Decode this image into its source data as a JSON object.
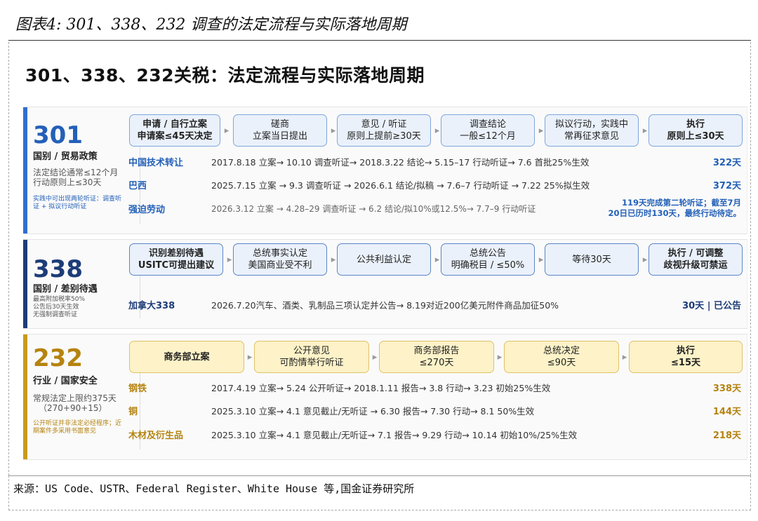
{
  "figure_title": "图表4: 301、338、232 调查的法定流程与实际落地周期",
  "main_title": "301、338、232关税：法定流程与实际落地周期",
  "source": "来源：US Code、USTR、Federal Register、White House 等,国金证券研究所",
  "colors": {
    "blue": "#2360b8",
    "navy": "#1d3c78",
    "gold": "#b58310"
  },
  "s301": {
    "number": "301",
    "category": "国别 / 贸易政策",
    "note1": "法定结论通常≤12个月",
    "note2": "行动原则上≤30天",
    "note3": "实践中可出现两轮听证：调查听证 + 拟议行动听证",
    "steps": [
      {
        "l1": "申请 / 自行立案",
        "l2": "申请案≤45天决定"
      },
      {
        "l1": "磋商",
        "l2": "立案当日提出"
      },
      {
        "l1": "意见 / 听证",
        "l2": "原则上提前≥30天"
      },
      {
        "l1": "调查结论",
        "l2": "一般≤12个月"
      },
      {
        "l1": "拟议行动，实践中",
        "l2": "常再征求意见"
      },
      {
        "l1": "执行",
        "l2": "原则上≤30天"
      }
    ],
    "cases": [
      {
        "name": "中国技术转让",
        "desc": "2017.8.18 立案→ 10.10 调查听证→ 2018.3.22 结论→ 5.15–17 行动听证→ 7.6 首批25%生效",
        "dur": "322天"
      },
      {
        "name": "巴西",
        "desc": "2025.7.15 立案 → 9.3 调查听证 → 2026.6.1 结论/拟稿 → 7.6–7 行动听证 → 7.22 25%拟生效",
        "dur": "372天"
      },
      {
        "name": "强迫劳动",
        "desc": "2026.3.12 立案 → 4.28–29 调查听证 → 6.2 结论/拟10%或12.5%→ 7.7–9 行动听证",
        "dur1": "119天完成第二轮听证；截至7月",
        "dur2": "20日已历时130天，最终行动待定。"
      }
    ]
  },
  "s338": {
    "number": "338",
    "category": "国别 / 差别待遇",
    "note1": "最高附加税率50%",
    "note2": "公告后30天生效",
    "note3": "无强制调查听证",
    "steps": [
      {
        "l1": "识别差别待遇",
        "l2": "USITC可提出建议"
      },
      {
        "l1": "总统事实认定",
        "l2": "美国商业受不利"
      },
      {
        "l1": "公共利益认定",
        "l2": ""
      },
      {
        "l1": "总统公告",
        "l2": "明确税目 / ≤50%"
      },
      {
        "l1": "等待30天",
        "l2": ""
      },
      {
        "l1": "执行 / 可调整",
        "l2": "歧视升级可禁运"
      }
    ],
    "cases": [
      {
        "name": "加拿大338",
        "desc": "2026.7.20汽车、酒类、乳制品三项认定并公告→ 8.19对近200亿美元附件商品加征50%",
        "dur": "30天 | 已公告"
      }
    ]
  },
  "s232": {
    "number": "232",
    "category": "行业 / 国家安全",
    "note1": "常规法定上限约375天",
    "note2": "（270+90+15）",
    "note3": "公开听证并非法定必经程序；近期案件多采用书面意见",
    "steps": [
      {
        "l1": "商务部立案",
        "l2": ""
      },
      {
        "l1": "公开意见",
        "l2": "可酌情举行听证"
      },
      {
        "l1": "商务部报告",
        "l2": "≤270天"
      },
      {
        "l1": "总统决定",
        "l2": "≤90天"
      },
      {
        "l1": "执行",
        "l2": "≤15天"
      }
    ],
    "cases": [
      {
        "name": "钢铁",
        "desc": "2017.4.19 立案→ 5.24 公开听证→ 2018.1.11 报告→ 3.8 行动→ 3.23 初始25%生效",
        "dur": "338天"
      },
      {
        "name": "铜",
        "desc": "2025.3.10 立案→ 4.1 意见截止/无听证 → 6.30 报告→ 7.30 行动→ 8.1 50%生效",
        "dur": "144天"
      },
      {
        "name": "木材及衍生品",
        "desc": "2025.3.10 立案→ 4.1 意见截止/无听证→ 7.1 报告→ 9.29 行动→ 10.14 初始10%/25%生效",
        "dur": "218天"
      }
    ]
  }
}
